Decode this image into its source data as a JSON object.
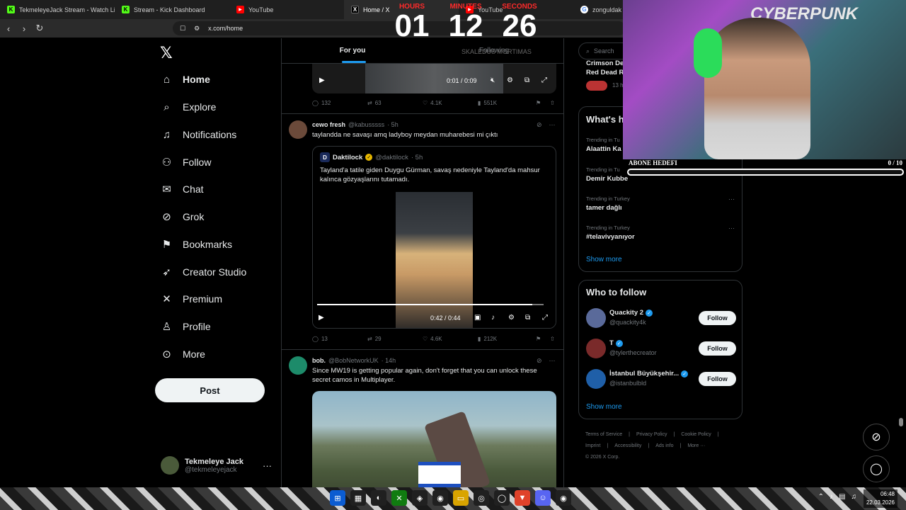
{
  "browser": {
    "tabs": [
      {
        "label": "TekmeleyeJack Stream - Watch Live o",
        "icon": "kick-icon",
        "active": false
      },
      {
        "label": "Stream - Kick Dashboard",
        "icon": "kick-icon",
        "active": false
      },
      {
        "label": "YouTube",
        "icon": "youtube-icon",
        "active": false
      },
      {
        "label": "Home / X",
        "icon": "x-icon",
        "active": true
      },
      {
        "label": "YouTube",
        "icon": "youtube-icon",
        "active": false
      },
      {
        "label": "zonguldak k",
        "icon": "google-icon",
        "active": false
      }
    ],
    "url": "x.com/home"
  },
  "nav": {
    "items": [
      {
        "label": "Home",
        "icon": "home-icon"
      },
      {
        "label": "Explore",
        "icon": "search-icon"
      },
      {
        "label": "Notifications",
        "icon": "bell-icon"
      },
      {
        "label": "Follow",
        "icon": "add-user-icon"
      },
      {
        "label": "Chat",
        "icon": "mail-icon"
      },
      {
        "label": "Grok",
        "icon": "grok-icon"
      },
      {
        "label": "Bookmarks",
        "icon": "bookmark-icon"
      },
      {
        "label": "Creator Studio",
        "icon": "rocket-icon"
      },
      {
        "label": "Premium",
        "icon": "x-icon"
      },
      {
        "label": "Profile",
        "icon": "person-icon"
      },
      {
        "label": "More",
        "icon": "more-circle-icon"
      }
    ],
    "post_label": "Post",
    "account": {
      "name": "Tekmeleye Jack",
      "handle": "@tekmeleyejack"
    }
  },
  "timeline": {
    "tabs": [
      "For you",
      "Following"
    ],
    "video1": {
      "time": "0:01 / 0:09"
    },
    "actions1": {
      "replies": "132",
      "reposts": "63",
      "likes": "4.1K",
      "views": "551K"
    },
    "tweet2": {
      "name": "cewo fresh",
      "handle": "@kabusssss",
      "time": "· 5h",
      "text": "taylandda ne savaşı amq ladyboy meydan muharebesi mi çıktı",
      "quote": {
        "name": "Daktilock",
        "handle": "@daktilock",
        "time": "· 5h",
        "text": "Tayland'a tatile giden Duygu Gürman, savaş nedeniyle Tayland'da mahsur kalınca gözyaşlarını tutamadı.",
        "video_time": "0:42 / 0:44",
        "progress": 0.95
      },
      "actions": {
        "replies": "13",
        "reposts": "29",
        "likes": "4.6K",
        "views": "212K"
      }
    },
    "tweet3": {
      "name": "bob.",
      "handle": "@BobNetworkUK",
      "time": "· 14h",
      "text": "Since MW19 is getting popular again, don't forget that you can unlock these secret camos in Multiplayer."
    }
  },
  "sidebar": {
    "search_placeholder": "Search",
    "live": {
      "title": "Crimson De",
      "subtitle": "Red Dead R",
      "meta": "13 h"
    },
    "trends_title": "What's h",
    "trends": [
      {
        "category": "Trending in Tu",
        "name": "Alaattin Ka"
      },
      {
        "category": "Trending in Tu",
        "name": "Demir Kubbe"
      },
      {
        "category": "Trending in Turkey",
        "name": "tamer dağlı"
      },
      {
        "category": "Trending in Turkey",
        "name": "#telavivyanıyor"
      }
    ],
    "show_more": "Show more",
    "who_title": "Who to follow",
    "who": [
      {
        "name": "Quackity 2",
        "handle": "@quackity4k",
        "follow": "Follow"
      },
      {
        "name": "T",
        "handle": "@tylerthecreator",
        "follow": "Follow"
      },
      {
        "name": "İstanbul Büyükşehir...",
        "handle": "@istanbulbld",
        "follow": "Follow"
      }
    ],
    "show_more2": "Show more",
    "footer": [
      "Terms of Service",
      "|",
      "Privacy Policy",
      "|",
      "Cookie Policy",
      "|",
      "Imprint",
      "|",
      "Accessibility",
      "|",
      "Ads info",
      "|",
      "More ···",
      "© 2026 X Corp."
    ]
  },
  "overlay": {
    "countdown": [
      {
        "label": "HOURS",
        "value": "01"
      },
      {
        "label": "MINUTES",
        "value": "12"
      },
      {
        "label": "SECONDS",
        "value": "26"
      }
    ],
    "countdown_sub": "SKALEDUS MORTIMAS",
    "webcam_title": "CYBERPUNK",
    "sub_goal": {
      "label": "ABONE HEDEFI",
      "count": "0 / 10",
      "progress": 0
    }
  },
  "taskbar": {
    "time": "06:48",
    "date": "22.03.2026"
  }
}
